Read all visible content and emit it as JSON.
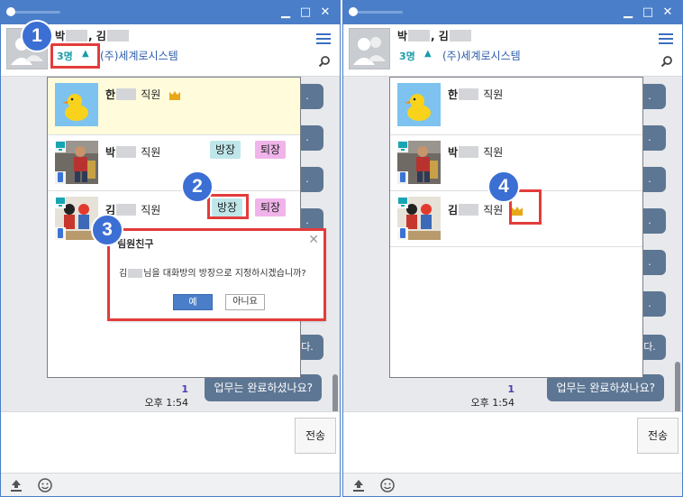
{
  "left_window": {
    "room_title": {
      "name1": "박",
      "sep": ",",
      "name2": "김"
    },
    "member_count": "3명",
    "org": "(주)세계로시스템",
    "members": [
      {
        "name": "한",
        "role": "직원",
        "is_owner": true
      },
      {
        "name": "박",
        "role": "직원",
        "owner_btn": "방장",
        "leave_btn": "퇴장"
      },
      {
        "name": "김",
        "role": "직원",
        "owner_btn": "방장",
        "leave_btn": "퇴장"
      }
    ],
    "dialog": {
      "title": "팀원친구",
      "message_prefix": "김",
      "message_suffix": "님을 대화방의 방장으로 지정하시겠습니까?",
      "yes": "예",
      "no": "아니요"
    },
    "message": {
      "read_count": "1",
      "time": "오후 1:54",
      "text": "업무는 완료하셨나요?"
    },
    "side_bubble_texts": [
      ".",
      ".",
      ".",
      "."
    ],
    "send_label": "전송"
  },
  "right_window": {
    "room_title": {
      "name1": "박",
      "sep": ",",
      "name2": "김"
    },
    "member_count": "3명",
    "org": "(주)세계로시스템",
    "members": [
      {
        "name": "한",
        "role": "직원"
      },
      {
        "name": "박",
        "role": "직원"
      },
      {
        "name": "김",
        "role": "직원",
        "is_owner": true
      }
    ],
    "message": {
      "read_count": "1",
      "time": "오후 1:54",
      "text": "업무는 완료하셨나요?"
    },
    "side_bubble_texts": [
      ".",
      ".",
      ".",
      ".",
      ".",
      "다.",
      "."
    ],
    "send_label": "전송"
  },
  "left_side_extra": {
    "bubble_text": "다."
  },
  "step_markers": [
    "1",
    "2",
    "3",
    "4"
  ],
  "colors": {
    "titlebar": "#4a7ec9",
    "highlight_row": "#fffbdb",
    "owner_button": "#bfe7ea",
    "leave_button": "#f0b4ea",
    "annotation_red": "#e33c3c",
    "step_blue": "#3b6fd4",
    "bubble": "#5d7693",
    "crown": "#e6a817"
  },
  "icons": [
    "window-minimize-icon",
    "window-maximize-icon",
    "window-close-icon",
    "hamburger-menu-icon",
    "search-icon",
    "crown-icon",
    "pc-device-icon",
    "mobile-device-icon",
    "upload-icon",
    "emoticon-icon",
    "default-avatar-icon"
  ]
}
